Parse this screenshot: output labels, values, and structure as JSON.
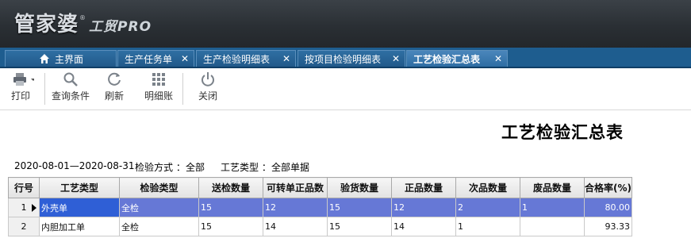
{
  "app": {
    "logo_text": "管家婆",
    "logo_reg": "®",
    "logo_sub": "工贸PRO"
  },
  "tabs": [
    {
      "label": "主界面",
      "icon": "home-icon",
      "closable": false,
      "active": false
    },
    {
      "label": "生产任务单",
      "closable": true,
      "active": false
    },
    {
      "label": "生产检验明细表",
      "closable": true,
      "active": false
    },
    {
      "label": "按项目检验明细表",
      "closable": true,
      "active": false
    },
    {
      "label": "工艺检验汇总表",
      "closable": true,
      "active": true
    }
  ],
  "toolbar": {
    "print": "打印",
    "query": "查询条件",
    "refresh": "刷新",
    "detail": "明细账",
    "close": "关闭"
  },
  "report": {
    "title": "工艺检验汇总表",
    "date_range": "2020-08-01—2020-08-31",
    "inspect_method_label": "检验方式 ：",
    "inspect_method_value": "全部",
    "process_type_label": "工艺类型 ：",
    "process_type_value": "全部单据"
  },
  "table": {
    "headers": [
      "行号",
      "工艺类型",
      "检验类型",
      "送检数量",
      "可转单正品数",
      "验货数量",
      "正品数量",
      "次品数量",
      "废品数量",
      "合格率(%)"
    ],
    "rows": [
      [
        "1",
        "外壳单",
        "全检",
        "15",
        "12",
        "15",
        "12",
        "2",
        "1",
        "80.00"
      ],
      [
        "2",
        "内胆加工单",
        "全检",
        "15",
        "14",
        "15",
        "14",
        "1",
        "",
        "93.33"
      ]
    ]
  },
  "colors": {
    "header_bg": "#2a2f34",
    "tabbar_bg": "#1e5d8f",
    "selected_row": "#6678d6"
  }
}
